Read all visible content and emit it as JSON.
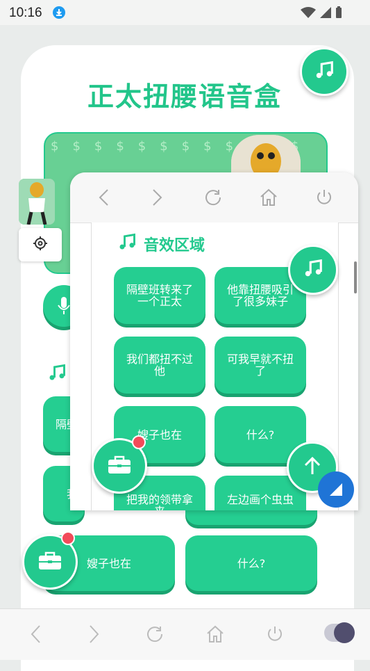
{
  "status_bar": {
    "time": "10:16"
  },
  "app": {
    "title": "正太扭腰语音盒"
  },
  "overlay": {
    "section_title": "音效区域",
    "buttons": [
      {
        "label": "隔壁班转来了一个正太"
      },
      {
        "label": "他靠扭腰吸引了很多妹子"
      },
      {
        "label": "我们都扭不过他"
      },
      {
        "label": "可我早就不扭了"
      },
      {
        "label": "嫂子也在"
      },
      {
        "label": "什么?"
      },
      {
        "label": "把我的领带拿来"
      },
      {
        "label": "左边画个虫虫"
      }
    ]
  },
  "background": {
    "partial_left_labels": [
      "隔壁",
      "我"
    ],
    "buttons": [
      {
        "label": "嫂子也在"
      },
      {
        "label": "什么?"
      }
    ]
  },
  "colors": {
    "accent": "#23c98e",
    "accent_dark": "#19a370",
    "badge": "#f24b5a",
    "blue": "#1f74d6"
  },
  "icons": [
    "download-icon",
    "wifi-icon",
    "signal-icon",
    "battery-icon",
    "music-note-icon",
    "gear-icon",
    "microphone-icon",
    "toolbox-icon",
    "arrow-up-icon",
    "back-icon",
    "forward-icon",
    "reload-icon",
    "home-icon",
    "power-icon"
  ]
}
